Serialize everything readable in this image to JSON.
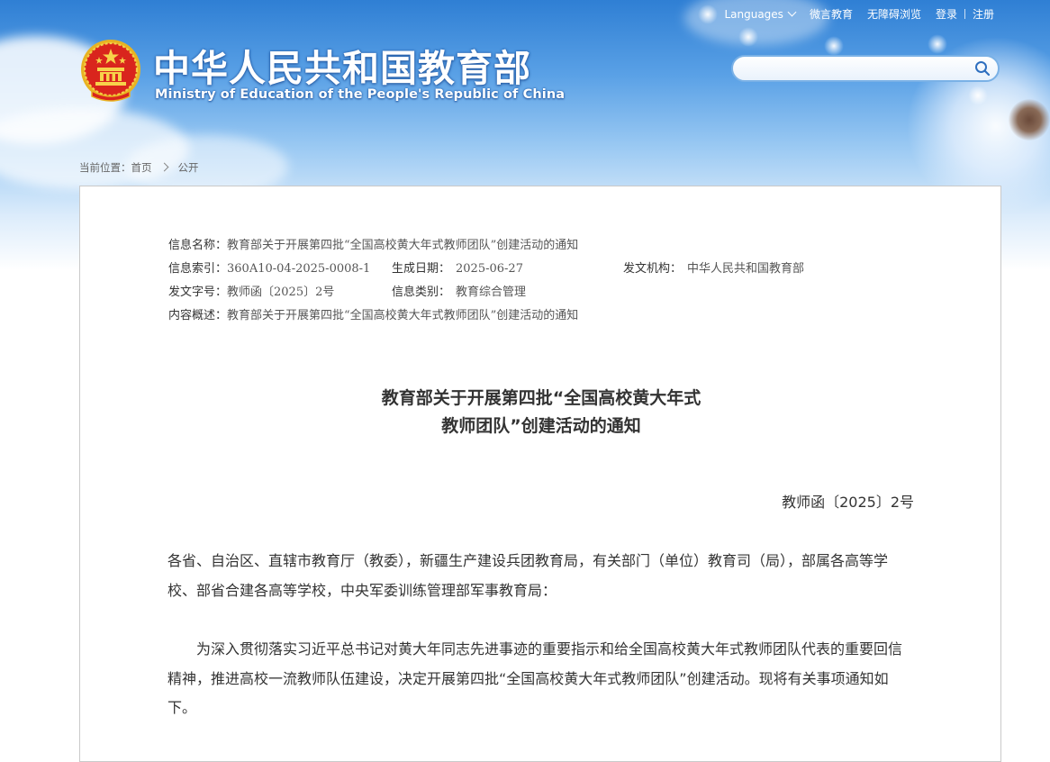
{
  "header": {
    "nav": {
      "languages": "Languages",
      "wechat": "微言教育",
      "accessibility": "无障碍浏览",
      "login": "登录",
      "register": "注册"
    },
    "site_title_cn": "中华人民共和国教育部",
    "site_title_en": "Ministry of Education of the People's Republic of China",
    "search": {
      "value": "",
      "placeholder": ""
    }
  },
  "breadcrumb": {
    "label": "当前位置：",
    "home": "首页",
    "section": "公开"
  },
  "info": {
    "name_label": "信息名称：",
    "name_value": "教育部关于开展第四批“全国高校黄大年式教师团队”创建活动的通知",
    "index_label": "信息索引：",
    "index_value": "360A10-04-2025-0008-1",
    "date_label": "生成日期：",
    "date_value": "2025-06-27",
    "issuer_label": "发文机构：",
    "issuer_value": "中华人民共和国教育部",
    "doc_no_label": "发文字号：",
    "doc_no_value": "教师函〔2025〕2号",
    "category_label": "信息类别：",
    "category_value": "教育综合管理",
    "summary_label": "内容概述：",
    "summary_value": "教育部关于开展第四批“全国高校黄大年式教师团队”创建活动的通知"
  },
  "document": {
    "title_line1": "教育部关于开展第四批“全国高校黄大年式",
    "title_line2": "教师团队”创建活动的通知",
    "number": "教师函〔2025〕2号",
    "addressee": "各省、自治区、直辖市教育厅（教委），新疆生产建设兵团教育局，有关部门（单位）教育司（局），部属各高等学校、部省合建各高等学校，中央军委训练管理部军事教育局：",
    "paragraph1": "为深入贯彻落实习近平总书记对黄大年同志先进事迹的重要指示和给全国高校黄大年式教师团队代表的重要回信精神，推进高校一流教师队伍建设，决定开展第四批“全国高校黄大年式教师团队”创建活动。现将有关事项通知如下。"
  },
  "colors": {
    "sky_top": "#2f7fd4",
    "sky_bottom": "#dcecfb",
    "text": "#333333",
    "border": "#c9c9c9"
  },
  "icons": [
    "national-emblem-icon",
    "search-icon",
    "chevron-down-icon",
    "chevron-right-icon"
  ]
}
